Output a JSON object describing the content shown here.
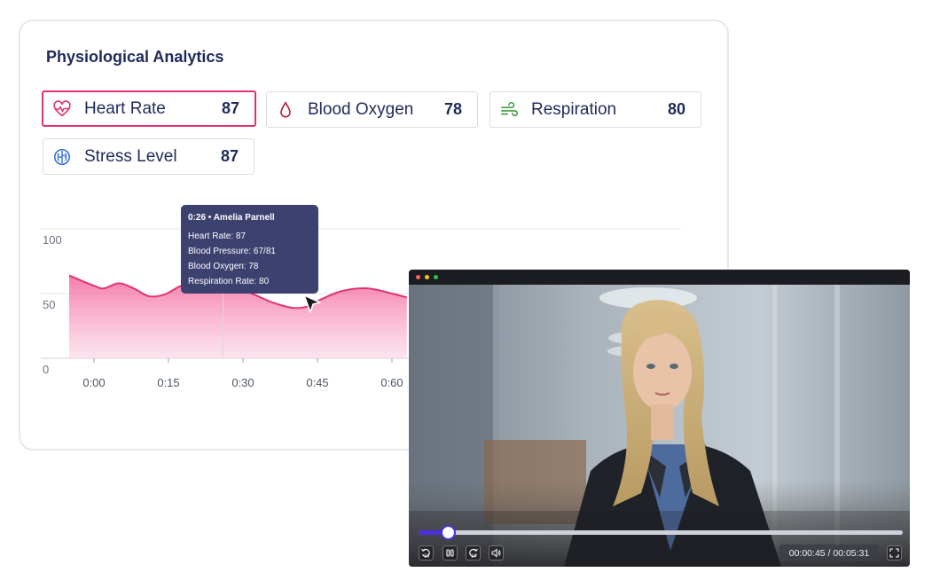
{
  "panel": {
    "title": "Physiological Analytics"
  },
  "metrics": [
    {
      "label": "Heart Rate",
      "value": "87",
      "icon": "heart-pulse-icon",
      "active": true
    },
    {
      "label": "Blood Oxygen",
      "value": "78",
      "icon": "blood-drop-icon",
      "active": false
    },
    {
      "label": "Respiration",
      "value": "80",
      "icon": "wind-icon",
      "active": false
    },
    {
      "label": "Stress Level",
      "value": "87",
      "icon": "brain-icon",
      "active": false
    }
  ],
  "colors": {
    "accent": "#e0336e",
    "navy": "#1f2a5a",
    "tooltip": "#3d4170",
    "progress": "#4e2ee0"
  },
  "chart_data": {
    "type": "area",
    "x_ticks": [
      "0:00",
      "0:15",
      "0:30",
      "0:45",
      "0:60"
    ],
    "y_ticks": [
      "100",
      "50",
      "0"
    ],
    "ylim": [
      0,
      100
    ],
    "xlim_seconds": [
      -5,
      80
    ],
    "series": [
      {
        "x": [
          -5,
          0,
          2,
          5,
          8,
          11,
          14,
          17,
          20,
          22,
          24,
          26,
          28,
          30,
          33,
          36,
          40,
          43,
          46,
          50,
          55,
          60,
          63
        ],
        "y": [
          64,
          56,
          54,
          58,
          54,
          48,
          49,
          55,
          60,
          63,
          65,
          63,
          57,
          53,
          48,
          43,
          39,
          40,
          46,
          52,
          54,
          50,
          47
        ]
      }
    ],
    "highlight": {
      "x": 26,
      "y": 65
    }
  },
  "tooltip": {
    "header": "0:26 • Amelia Parnell",
    "lines": [
      "Heart Rate: 87",
      "Blood Pressure: 67/81",
      "Blood Oxygen: 78",
      "Respiration Rate: 80"
    ]
  },
  "player": {
    "time": "00:00:45 / 00:05:31",
    "progress": 0.061,
    "window_dots": [
      "#ff5f56",
      "#ffbd2e",
      "#27c93f"
    ]
  }
}
